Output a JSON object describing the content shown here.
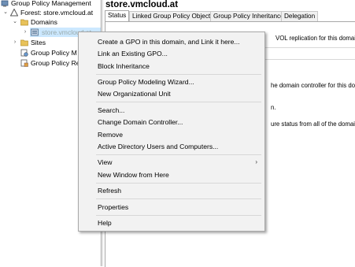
{
  "tree": {
    "items": [
      {
        "label": "Group Policy Management",
        "icon": "gpm-console-icon"
      },
      {
        "label": "Forest: store.vmcloud.at",
        "icon": "forest-icon"
      },
      {
        "label": "Domains",
        "icon": "folder-icon"
      },
      {
        "label": "store.vmcloud.at",
        "icon": "domain-icon"
      },
      {
        "label": "Sites",
        "icon": "sites-icon"
      },
      {
        "label": "Group Policy M",
        "icon": "gp-modeling-icon"
      },
      {
        "label": "Group Policy Re",
        "icon": "gp-results-icon"
      }
    ]
  },
  "main": {
    "title": "store.vmcloud.at",
    "tabs": [
      {
        "label": "Status"
      },
      {
        "label": "Linked Group Policy Objects"
      },
      {
        "label": "Group Policy Inheritance"
      },
      {
        "label": "Delegation"
      }
    ],
    "content": {
      "line1": "VOL replication for this domain as it",
      "line2": "he domain controller for this doma",
      "line3": "n.",
      "line4": "ure status from all of the domain con"
    }
  },
  "context_menu": {
    "items": [
      {
        "label": "Create a GPO in this domain, and Link it here..."
      },
      {
        "label": "Link an Existing GPO..."
      },
      {
        "label": "Block Inheritance"
      },
      {
        "label": "Group Policy Modeling Wizard..."
      },
      {
        "label": "New Organizational Unit"
      },
      {
        "label": "Search..."
      },
      {
        "label": "Change Domain Controller..."
      },
      {
        "label": "Remove"
      },
      {
        "label": "Active Directory Users and Computers..."
      },
      {
        "label": "View",
        "submenu_arrow": "›"
      },
      {
        "label": "New Window from Here"
      },
      {
        "label": "Refresh"
      },
      {
        "label": "Properties"
      },
      {
        "label": "Help"
      }
    ]
  },
  "colors": {
    "selection": "#cce8ff",
    "menu_bg": "#f2f2f2",
    "menu_border": "#a9a9a9"
  }
}
